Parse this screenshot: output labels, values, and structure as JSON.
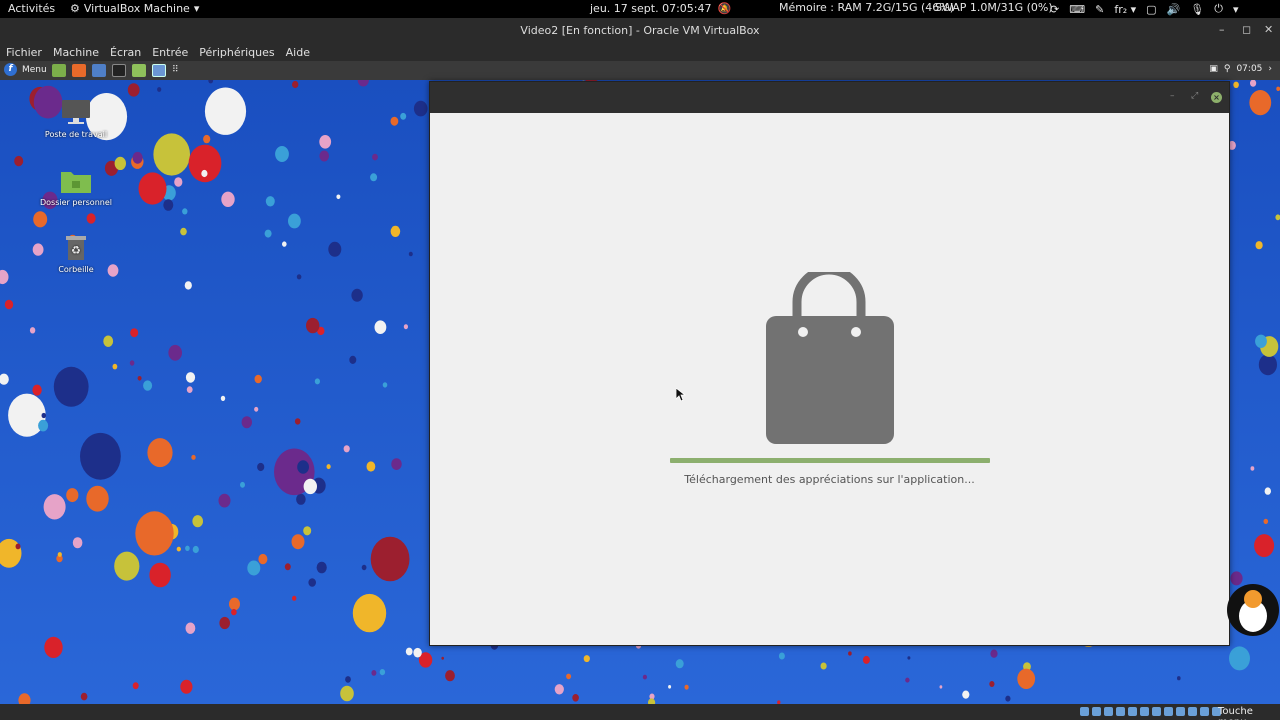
{
  "gnome_bar": {
    "activities": "Activités",
    "app_menu": "VirtualBox Machine",
    "clock": "jeu. 17 sept.  07:05:47",
    "memory": "Mémoire : RAM 7.2G/15G (46%)",
    "swap": "SWAP 1.0M/31G (0%)",
    "keyboard": "fr₂"
  },
  "vbox": {
    "title": "Video2 [En fonction] - Oracle VM VirtualBox",
    "menu": [
      "Fichier",
      "Machine",
      "Écran",
      "Entrée",
      "Périphériques",
      "Aide"
    ]
  },
  "guest_panel": {
    "menu_label": "Menu",
    "time": "07:05"
  },
  "desktop_icons": [
    {
      "label": "Poste de travail"
    },
    {
      "label": "Dossier personnel"
    },
    {
      "label": "Corbeille"
    }
  ],
  "app_window": {
    "status": "Téléchargement des appréciations sur l'application...",
    "progress": 1.0
  },
  "bottom_bar": {
    "host_key": "Touche menu"
  },
  "colors": {
    "desktop_blue": "#1c55c8",
    "progress_green": "#8caf6e",
    "bag_gray": "#727272"
  }
}
